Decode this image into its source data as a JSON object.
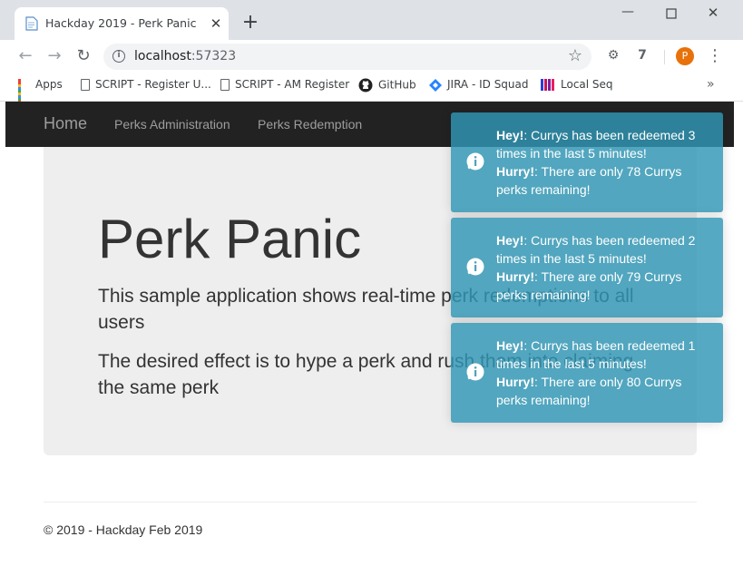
{
  "browser": {
    "tab_title": "Hackday 2019 - Perk Panic",
    "url_host": "localhost",
    "url_port": ":57323",
    "avatar_letter": "P",
    "bookmarks": [
      {
        "label": "Apps",
        "icon": "apps-icon"
      },
      {
        "label": "SCRIPT - Register U...",
        "icon": "page-icon"
      },
      {
        "label": "SCRIPT - AM Register",
        "icon": "page-icon"
      },
      {
        "label": "GitHub",
        "icon": "github-icon"
      },
      {
        "label": "JIRA - ID Squad",
        "icon": "jira-icon"
      },
      {
        "label": "Local Seq",
        "icon": "seq-icon"
      }
    ]
  },
  "navbar": {
    "brand": "Home",
    "links": [
      "Perks Administration",
      "Perks Redemption"
    ]
  },
  "jumbotron": {
    "title": "Perk Panic",
    "paragraphs": [
      "This sample application shows real-time perk redemptions to all users",
      "The desired effect is to hype a perk and rush them into claiming the same perk"
    ]
  },
  "footer": {
    "text": "© 2019 - Hackday Feb 2019"
  },
  "toasts": [
    {
      "hey": "Hey!",
      "hey_msg": ": Currys has been redeemed 3 times in the last 5 minutes!",
      "hurry": "Hurry!",
      "hurry_msg": ": There are only 78 Currys perks remaining!"
    },
    {
      "hey": "Hey!",
      "hey_msg": ": Currys has been redeemed 2 times in the last 5 minutes!",
      "hurry": "Hurry!",
      "hurry_msg": ": There are only 79 Currys perks remaining!"
    },
    {
      "hey": "Hey!",
      "hey_msg": ": Currys has been redeemed 1 times in the last 5 minutes!",
      "hurry": "Hurry!",
      "hurry_msg": ": There are only 80 Currys perks remaining!"
    }
  ],
  "colors": {
    "navbar_bg": "#222222",
    "jumbotron_bg": "#eeeeee",
    "toast_bg": "#2f96b4",
    "avatar_bg": "#e8710a"
  }
}
